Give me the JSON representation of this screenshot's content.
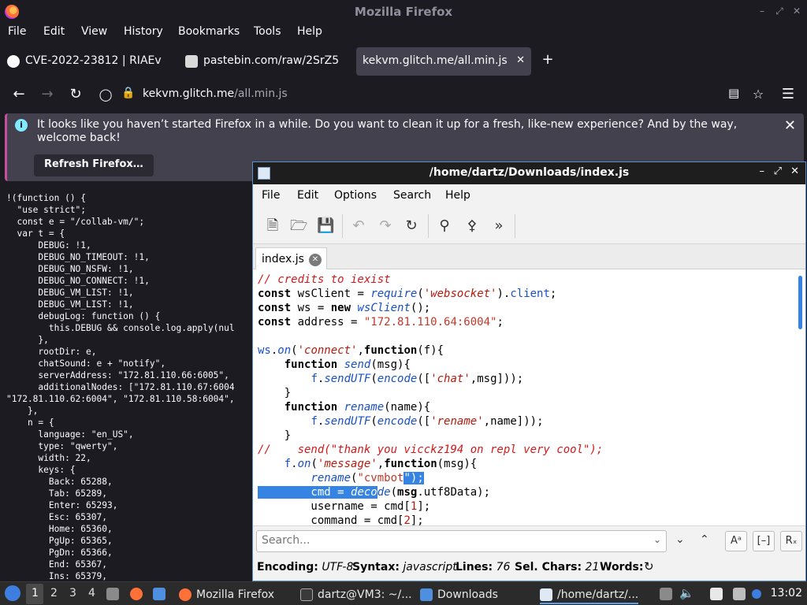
{
  "firefox": {
    "window_title": "Mozilla Firefox",
    "menu": [
      "File",
      "Edit",
      "View",
      "History",
      "Bookmarks",
      "Tools",
      "Help"
    ],
    "tabs": [
      {
        "label": "CVE-2022-23812 | RIAEv",
        "icon": "github-icon"
      },
      {
        "label": "pastebin.com/raw/2SrZ5",
        "icon": "pastebin-icon"
      },
      {
        "label": "kekvm.glitch.me/all.min.js",
        "icon": "none",
        "active": true
      }
    ],
    "url": {
      "host": "kekvm.glitch.me",
      "path": "/all.min.js"
    },
    "notification": {
      "message": "It looks like you haven’t started Firefox in a while. Do you want to clean it up for a fresh, like-new experience? And by the way, welcome back!",
      "button": "Refresh Firefox…"
    },
    "page_code": [
      "!(function () {",
      "  \"use strict\";",
      "  const e = \"/collab-vm/\";",
      "  var t = {",
      "      DEBUG: !1,",
      "      DEBUG_NO_TIMEOUT: !1,",
      "      DEBUG_NO_NSFW: !1,",
      "      DEBUG_NO_CONNECT: !1,",
      "      DEBUG_VM_LIST: !1,",
      "      DEBUG_VM_LIST: !1,",
      "      debugLog: function () {",
      "        this.DEBUG && console.log.apply(nul",
      "      },",
      "      rootDir: e,",
      "      chatSound: e + \"notify\",",
      "      serverAddress: \"172.81.110.66:6005\",",
      "      additionalNodes: [\"172.81.110.67:6004",
      "\"172.81.110.62:6004\", \"172.81.110.58:6004\",",
      "    },",
      "    n = {",
      "      language: \"en_US\",",
      "      type: \"qwerty\",",
      "      width: 22,",
      "      keys: {",
      "        Back: 65288,",
      "        Tab: 65289,",
      "        Enter: 65293,",
      "        Esc: 65307,",
      "        Home: 65360,",
      "        PgUp: 65365,",
      "        PgDn: 65366,",
      "        End: 65367,",
      "        Ins: 65379,"
    ]
  },
  "editor": {
    "title": "/home/dartz/Downloads/index.js",
    "menu": [
      "File",
      "Edit",
      "Options",
      "Search",
      "Help"
    ],
    "tab_label": "index.js",
    "search_placeholder": "Search...",
    "status": {
      "encoding_label": "Encoding:",
      "encoding": "UTF-8",
      "syntax_label": "Syntax:",
      "syntax": "javascript",
      "lines_label": "Lines:",
      "lines": "76",
      "sel_label": "Sel. Chars:",
      "sel": "21",
      "words_label": "Words:"
    }
  },
  "taskbar": {
    "workspaces": [
      "1",
      "2",
      "3",
      "4"
    ],
    "tasks": [
      {
        "label": "Mozilla Firefox"
      },
      {
        "label": "dartz@VM3: ~/..."
      },
      {
        "label": "Downloads"
      },
      {
        "label": "/home/dartz/..."
      }
    ],
    "clock": "13:02"
  }
}
